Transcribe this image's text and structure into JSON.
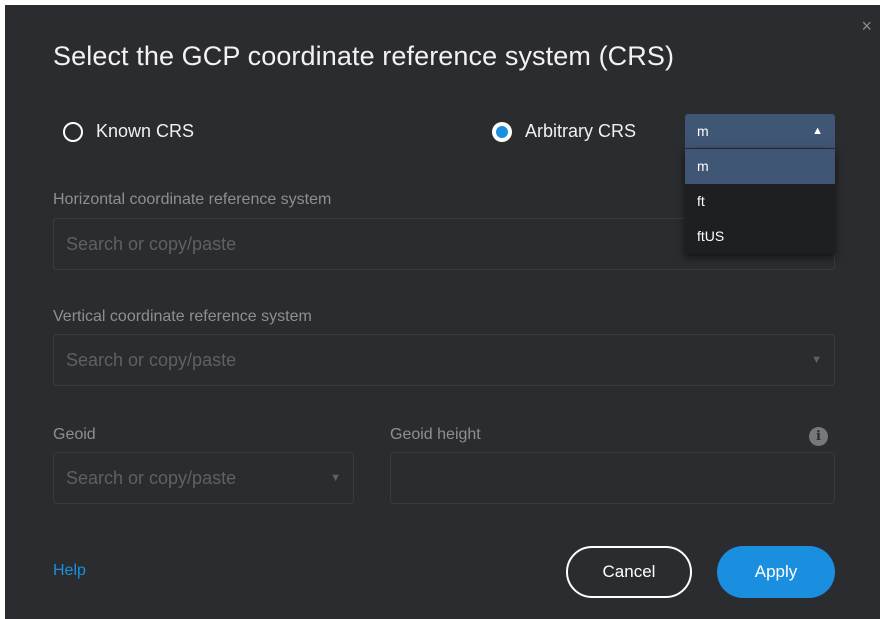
{
  "dialog": {
    "title": "Select the GCP coordinate reference system (CRS)",
    "close_glyph": "×"
  },
  "mode": {
    "known_label": "Known CRS",
    "known_selected": false,
    "arbitrary_label": "Arbitrary CRS",
    "arbitrary_selected": true
  },
  "unit_select": {
    "value": "m",
    "options": [
      "m",
      "ft",
      "ftUS"
    ],
    "chevron": "^"
  },
  "horizontal": {
    "label": "Horizontal coordinate reference system",
    "placeholder": "Search or copy/paste"
  },
  "vertical": {
    "label": "Vertical coordinate reference system",
    "placeholder": "Search or copy/paste",
    "chevron": "v"
  },
  "geoid": {
    "label": "Geoid",
    "placeholder": "Search or copy/paste",
    "chevron": "v"
  },
  "geoid_height": {
    "label": "Geoid height",
    "value": "",
    "info_glyph": "i"
  },
  "footer": {
    "help_label": "Help",
    "cancel_label": "Cancel",
    "apply_label": "Apply"
  },
  "colors": {
    "dialog_bg": "#2b2c2f",
    "accent": "#1a8fe0",
    "selected_option_bg": "#3f5675"
  }
}
